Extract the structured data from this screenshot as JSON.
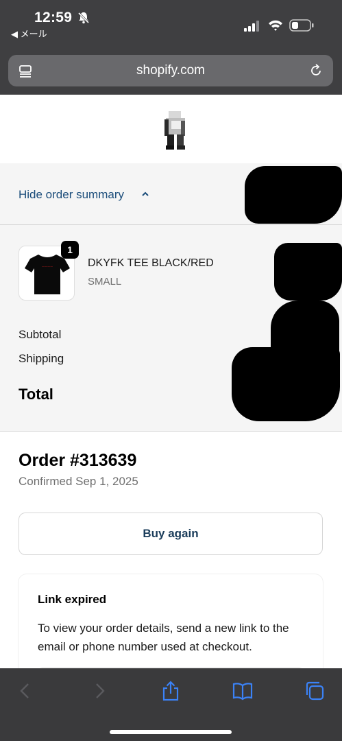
{
  "status_bar": {
    "time": "12:59",
    "back_app": "◀ メール"
  },
  "url_bar": {
    "domain": "shopify.com"
  },
  "order_summary": {
    "toggle_label": "Hide order summary",
    "product": {
      "name": "DKYFK TEE BLACK/RED",
      "variant": "SMALL",
      "quantity": "1"
    },
    "subtotal_label": "Subtotal",
    "shipping_label": "Shipping",
    "total_label": "Total"
  },
  "order": {
    "title": "Order #313639",
    "confirmed": "Confirmed Sep 1, 2025",
    "buy_again_label": "Buy again"
  },
  "link_card": {
    "title": "Link expired",
    "body": "To view your order details, send a new link to the email or phone number used at checkout."
  },
  "colors": {
    "link": "#1a4c7a",
    "toolbar_icon": "#3b82f6",
    "toolbar_bg": "#3a3a3c"
  },
  "toolbar": {
    "icons": [
      "back-icon",
      "forward-icon",
      "share-icon",
      "bookmarks-icon",
      "tabs-icon"
    ]
  }
}
